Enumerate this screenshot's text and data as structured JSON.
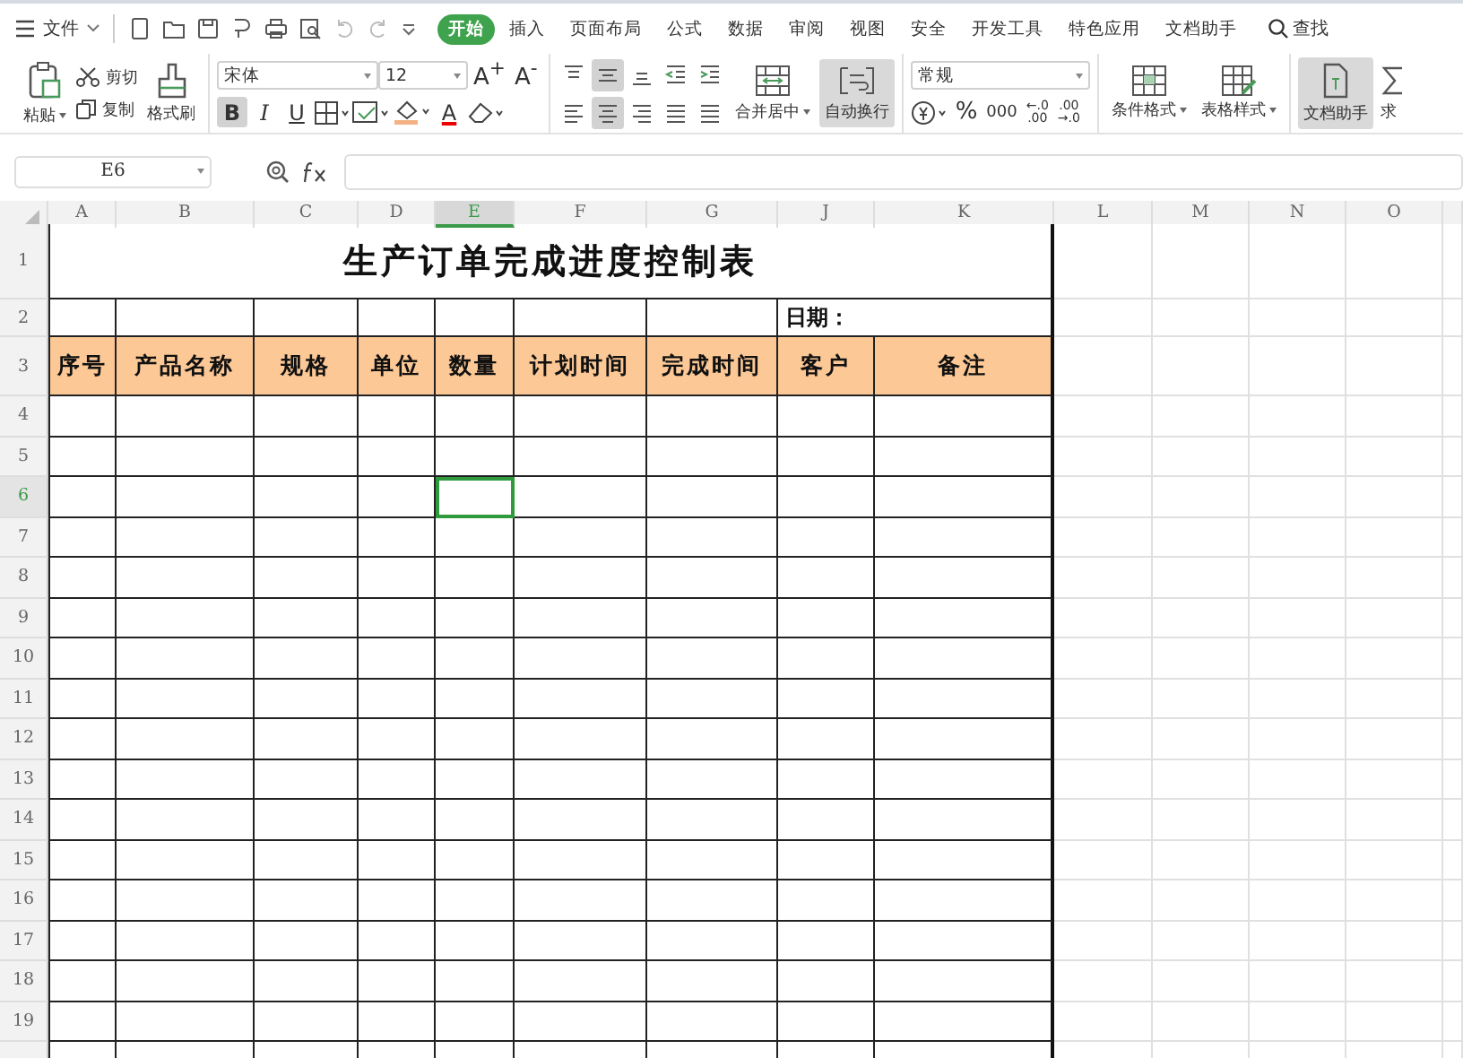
{
  "menu": {
    "file": "文件",
    "tabs": [
      {
        "label": "开始",
        "selected": true
      },
      {
        "label": "插入",
        "selected": false
      },
      {
        "label": "页面布局",
        "selected": false
      },
      {
        "label": "公式",
        "selected": false
      },
      {
        "label": "数据",
        "selected": false
      },
      {
        "label": "审阅",
        "selected": false
      },
      {
        "label": "视图",
        "selected": false
      },
      {
        "label": "安全",
        "selected": false
      },
      {
        "label": "开发工具",
        "selected": false
      },
      {
        "label": "特色应用",
        "selected": false
      },
      {
        "label": "文档助手",
        "selected": false
      }
    ],
    "search": "查找"
  },
  "ribbon": {
    "paste": "粘贴",
    "cut": "剪切",
    "copy": "复制",
    "format_painter": "格式刷",
    "font": "宋体",
    "font_size": "12",
    "grow_font": "A$^{+}$",
    "shrink_font": "A$^{-}$",
    "styles": [
      {
        "label": "B",
        "selected": true
      },
      {
        "label": "I",
        "selected": false
      },
      {
        "label": "U",
        "selected": false
      }
    ],
    "font_color": "A",
    "vertical_align": [
      {
        "kind": "top",
        "selected": false
      },
      {
        "kind": "middle",
        "selected": true
      },
      {
        "kind": "bottom",
        "selected": false
      },
      {
        "kind": "outdent",
        "selected": false
      },
      {
        "kind": "indent",
        "selected": false
      }
    ],
    "horizontal_align": [
      {
        "kind": "left",
        "selected": false
      },
      {
        "kind": "center",
        "selected": true
      },
      {
        "kind": "right",
        "selected": false
      },
      {
        "kind": "justify",
        "selected": false
      },
      {
        "kind": "distribute",
        "selected": false
      }
    ],
    "merge": "合并居中",
    "wrap": {
      "label": "自动换行",
      "on": true
    },
    "number_format": "常规",
    "number_buttons": [
      {
        "kind": "currency"
      },
      {
        "kind": "text",
        "label": "%"
      },
      {
        "kind": "text",
        "label": "000"
      },
      {
        "kind": "stack",
        "lines": [
          "←.0",
          ".00"
        ]
      },
      {
        "kind": "stack",
        "lines": [
          ".00",
          "→.0"
        ]
      }
    ],
    "cond_format": "条件格式",
    "table_style": "表格样式",
    "doc_assistant": {
      "label": "文档助手",
      "on": true
    },
    "sum": "求"
  },
  "formula_bar": {
    "name_box": "E6"
  },
  "columns": [
    {
      "label": "A",
      "selected": false
    },
    {
      "label": "B",
      "selected": false
    },
    {
      "label": "C",
      "selected": false
    },
    {
      "label": "D",
      "selected": false
    },
    {
      "label": "E",
      "selected": true
    },
    {
      "label": "F",
      "selected": false
    },
    {
      "label": "G",
      "selected": false
    },
    {
      "label": "J",
      "selected": false
    },
    {
      "label": "K",
      "selected": false
    },
    {
      "label": "L",
      "selected": false
    },
    {
      "label": "M",
      "selected": false
    },
    {
      "label": "N",
      "selected": false
    },
    {
      "label": "O",
      "selected": false
    }
  ],
  "rows": [
    {
      "label": "1",
      "selected": false
    },
    {
      "label": "2",
      "selected": false
    },
    {
      "label": "3",
      "selected": false
    },
    {
      "label": "4",
      "selected": false
    },
    {
      "label": "5",
      "selected": false
    },
    {
      "label": "6",
      "selected": true
    },
    {
      "label": "7",
      "selected": false
    },
    {
      "label": "8",
      "selected": false
    },
    {
      "label": "9",
      "selected": false
    },
    {
      "label": "10",
      "selected": false
    },
    {
      "label": "11",
      "selected": false
    },
    {
      "label": "12",
      "selected": false
    },
    {
      "label": "13",
      "selected": false
    },
    {
      "label": "14",
      "selected": false
    },
    {
      "label": "15",
      "selected": false
    },
    {
      "label": "16",
      "selected": false
    },
    {
      "label": "17",
      "selected": false
    },
    {
      "label": "18",
      "selected": false
    },
    {
      "label": "19",
      "selected": false
    }
  ],
  "sheet": {
    "title": "生产订单完成进度控制表",
    "date_label": "日期：",
    "headers": [
      "序号",
      "产品名称",
      "规格",
      "单位",
      "数量",
      "计划时间",
      "完成时间",
      "客户",
      "备注"
    ]
  }
}
